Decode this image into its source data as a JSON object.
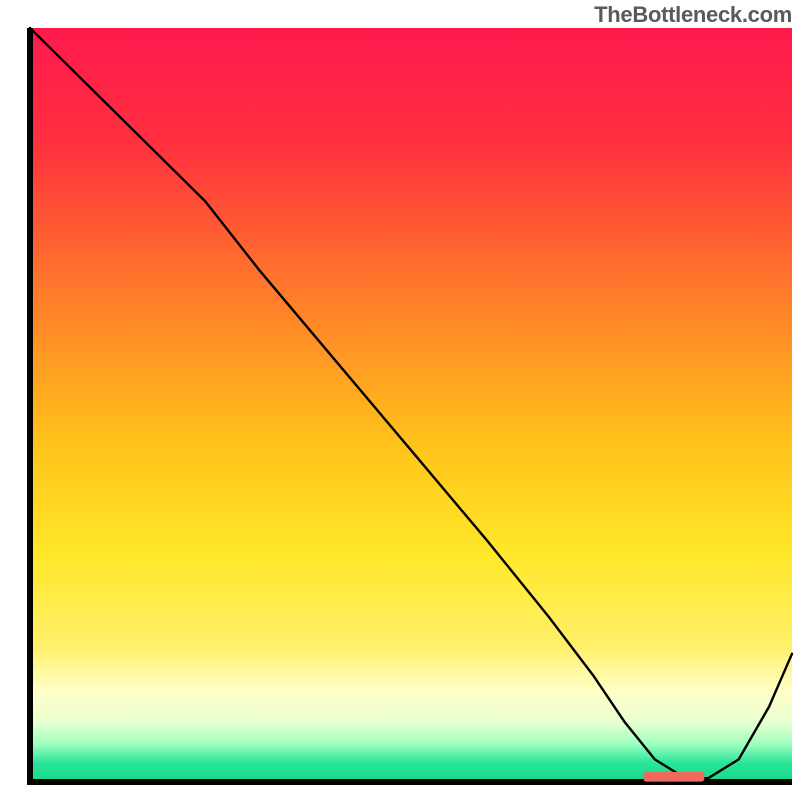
{
  "watermark": "TheBottleneck.com",
  "chart_data": {
    "type": "line",
    "title": "",
    "xlabel": "",
    "ylabel": "",
    "xlim": [
      0,
      100
    ],
    "ylim": [
      0,
      100
    ],
    "background_gradient_stops": [
      {
        "offset": 0.0,
        "color": "#ff1a4d"
      },
      {
        "offset": 0.15,
        "color": "#ff2f3f"
      },
      {
        "offset": 0.35,
        "color": "#ff7a2a"
      },
      {
        "offset": 0.55,
        "color": "#ffc21a"
      },
      {
        "offset": 0.7,
        "color": "#ffe82a"
      },
      {
        "offset": 0.82,
        "color": "#fff06a"
      },
      {
        "offset": 0.88,
        "color": "#ffffc8"
      },
      {
        "offset": 0.92,
        "color": "#e9ffd0"
      },
      {
        "offset": 0.95,
        "color": "#9dffbf"
      },
      {
        "offset": 0.975,
        "color": "#28e498"
      },
      {
        "offset": 1.0,
        "color": "#16d98e"
      }
    ],
    "series": [
      {
        "name": "bottleneck-curve",
        "color": "#000000",
        "width": 2.4,
        "x": [
          0,
          4,
          10,
          18,
          23,
          30,
          40,
          50,
          60,
          68,
          74,
          78,
          82,
          86,
          89,
          93,
          97,
          100
        ],
        "y": [
          100,
          96,
          90,
          82,
          77,
          68,
          56,
          44,
          32,
          22,
          14,
          8,
          3,
          0.5,
          0.5,
          3,
          10,
          17
        ]
      }
    ],
    "marker": {
      "name": "optimal-range-marker",
      "color": "#ef6a5b",
      "x_start": 80.5,
      "x_end": 88.5,
      "y": 0.7,
      "thickness": 1.3
    }
  }
}
